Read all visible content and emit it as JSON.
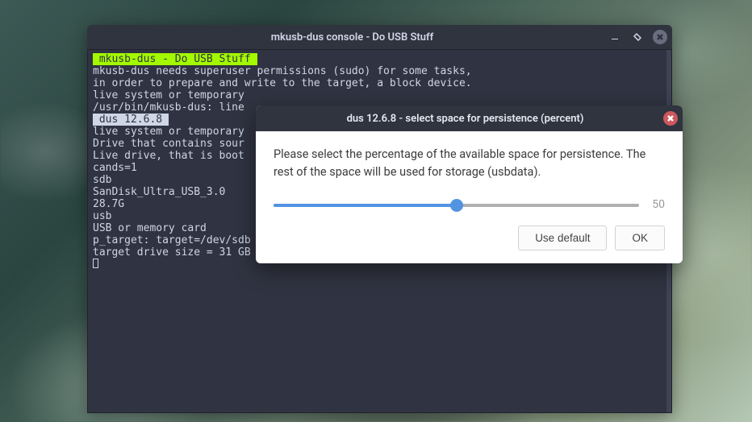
{
  "terminal": {
    "title": "mkusb-dus console - Do USB Stuff",
    "line_hl_green": " mkusb-dus - Do USB Stuff ",
    "line1": "mkusb-dus needs superuser permissions (sudo) for some tasks,",
    "line2": "in order to prepare and write to the target, a block device.",
    "line3": "live system or temporary",
    "line4": "/usr/bin/mkusb-dus: line",
    "line_hl_grey": " dus 12.6.8 ",
    "line5": "live system or temporary",
    "line6": "Drive that contains sour",
    "line7": "Live drive, that is boot",
    "line8": "cands=1",
    "line9": "sdb",
    "line10": "SanDisk_Ultra_USB_3.0",
    "line11": "28.7G",
    "line12": "usb",
    "line13": "USB or memory card",
    "line14": "p_target: target=/dev/sdb",
    "line15": "target drive size = 31 GB"
  },
  "dialog": {
    "title": "dus 12.6.8 - select space for persistence (percent)",
    "message": "Please select the percentage of the available space for persistence. The rest of the space will be used for storage (usbdata).",
    "slider_value": "50",
    "slider_percent_css": "50%",
    "use_default_label": "Use default",
    "ok_label": "OK"
  }
}
